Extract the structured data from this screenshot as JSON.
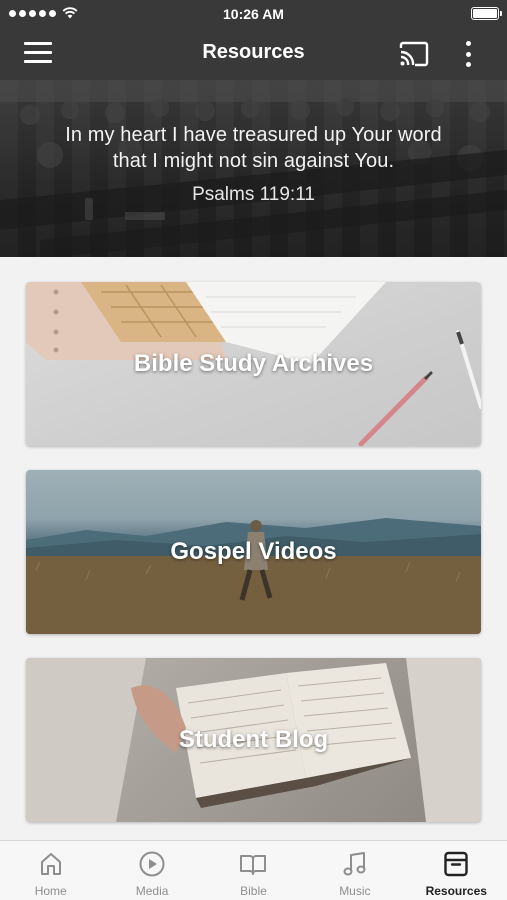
{
  "status_bar": {
    "time": "10:26 AM"
  },
  "nav": {
    "title": "Resources"
  },
  "hero": {
    "verse_line1": "In my heart I have treasured up Your word",
    "verse_line2": "that I might not sin against You.",
    "reference": "Psalms 119:11"
  },
  "cards": [
    {
      "label": "Bible Study Archives"
    },
    {
      "label": "Gospel Videos"
    },
    {
      "label": "Student Blog"
    }
  ],
  "tabs": [
    {
      "label": "Home",
      "icon": "home-icon"
    },
    {
      "label": "Media",
      "icon": "play-circle-icon"
    },
    {
      "label": "Bible",
      "icon": "open-book-icon"
    },
    {
      "label": "Music",
      "icon": "music-note-icon"
    },
    {
      "label": "Resources",
      "icon": "archive-box-icon",
      "active": true
    }
  ],
  "colors": {
    "header": "#393939",
    "tab_bar": "#f7f7f7",
    "active_tab": "#222222",
    "inactive_tab": "#8e8e8e"
  }
}
